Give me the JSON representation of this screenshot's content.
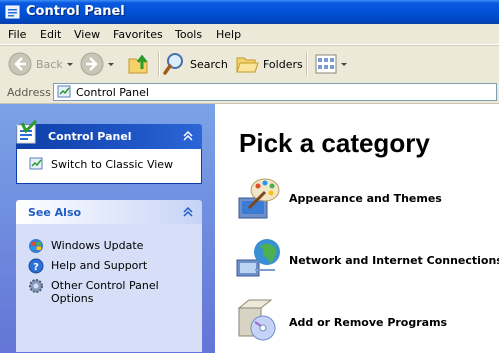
{
  "window": {
    "title": "Control Panel"
  },
  "menubar": {
    "items": [
      "File",
      "Edit",
      "View",
      "Favorites",
      "Tools",
      "Help"
    ]
  },
  "toolbar": {
    "back_label": "Back",
    "search_label": "Search",
    "folders_label": "Folders"
  },
  "address": {
    "label": "Address",
    "value": "Control Panel"
  },
  "leftpane": {
    "control_panel": {
      "title": "Control Panel",
      "switch_label": "Switch to Classic View"
    },
    "see_also": {
      "title": "See Also",
      "items": [
        {
          "label": "Windows Update",
          "icon": "windows-update-icon"
        },
        {
          "label": "Help and Support",
          "icon": "help-icon"
        },
        {
          "label": "Other Control Panel",
          "label2": "Options",
          "icon": "gear-icon"
        }
      ]
    }
  },
  "main": {
    "heading": "Pick a category",
    "categories": [
      {
        "label": "Appearance and Themes",
        "icon": "appearance-themes-icon"
      },
      {
        "label": "Network and Internet Connections",
        "icon": "network-icon"
      },
      {
        "label": "Add or Remove Programs",
        "icon": "add-remove-programs-icon"
      }
    ]
  },
  "colors": {
    "titlebar": "#0052d6",
    "chrome": "#ece9d8",
    "leftpane": "#7ba2e7",
    "panel_header": "#0c3fa8",
    "link": "#215dc6"
  }
}
